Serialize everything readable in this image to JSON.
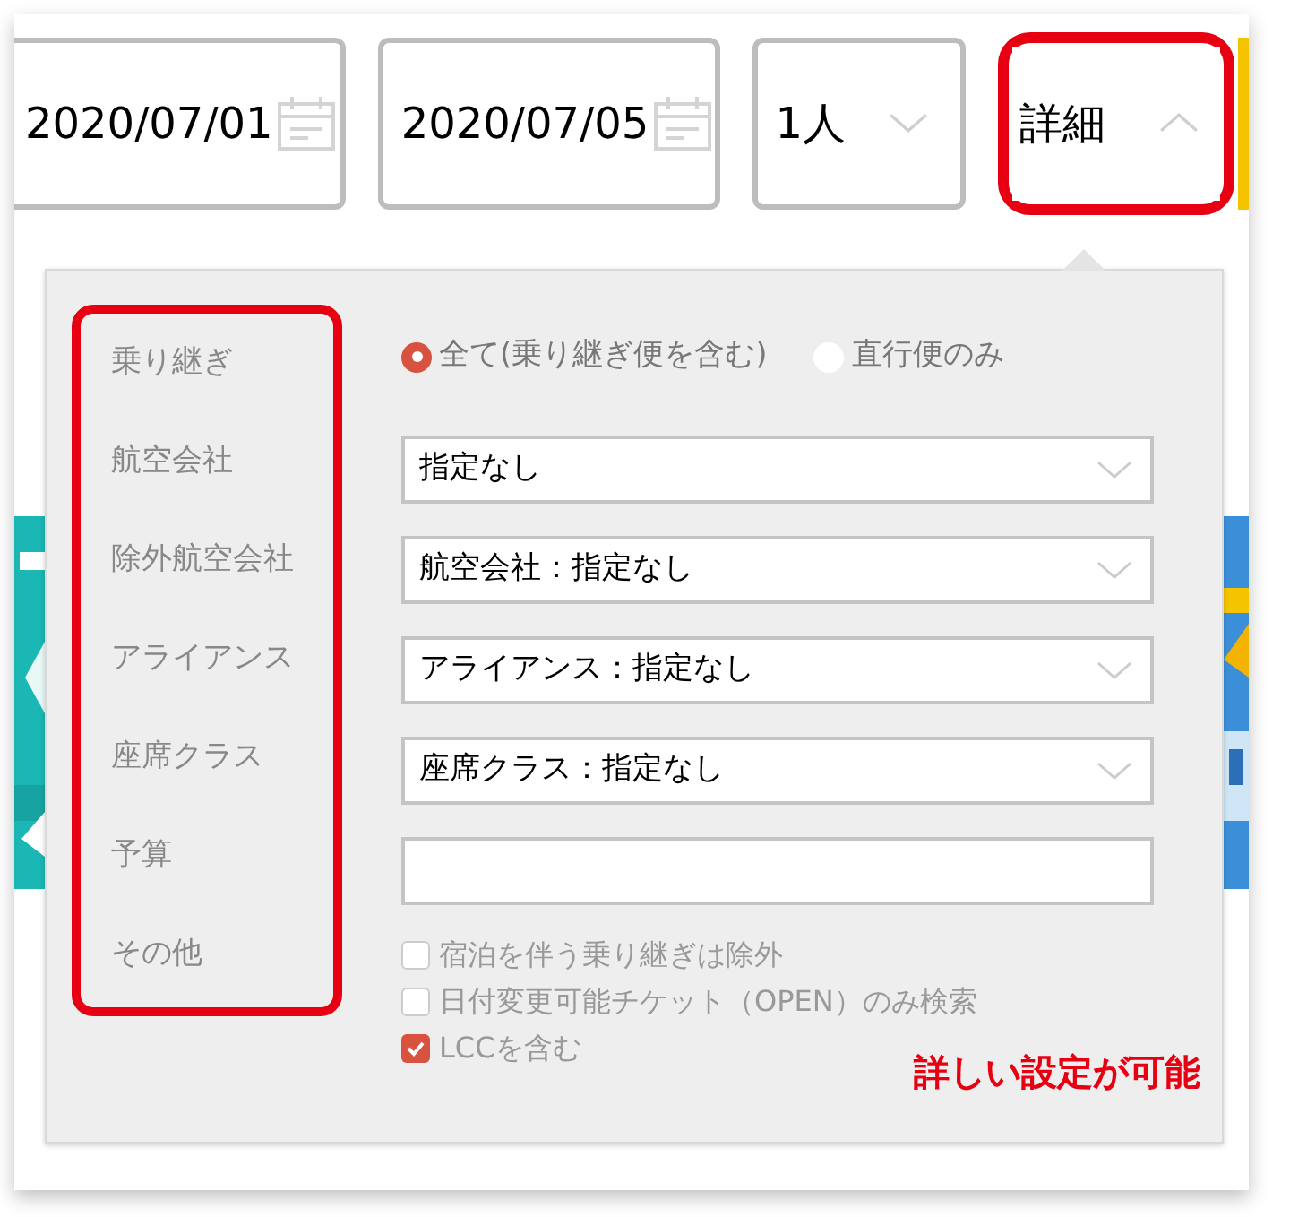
{
  "search_bar": {
    "fields": [
      {
        "kind": "date",
        "value": "2020/07/01"
      },
      {
        "kind": "date",
        "value": "2020/07/05"
      },
      {
        "kind": "select",
        "value": "1人"
      },
      {
        "kind": "toggle",
        "value": "詳細",
        "expanded": true,
        "highlighted": true
      }
    ]
  },
  "details_panel": {
    "labels_highlighted": true,
    "labels": [
      "乗り継ぎ",
      "航空会社",
      "除外航空会社",
      "アライアンス",
      "座席クラス",
      "予算",
      "その他"
    ],
    "transfer_options": [
      {
        "label": "全て(乗り継ぎ便を含む)",
        "selected": true
      },
      {
        "label": "直行便のみ",
        "selected": false
      }
    ],
    "selects": [
      "指定なし",
      "航空会社：指定なし",
      "アライアンス：指定なし",
      "座席クラス：指定なし"
    ],
    "checkboxes": [
      {
        "label": "宿泊を伴う乗り継ぎは除外",
        "checked": false
      },
      {
        "label": "日付変更可能チケット（OPEN）のみ検索",
        "checked": false
      },
      {
        "label": "LCCを含む",
        "checked": true
      }
    ],
    "annotation": "詳しい設定が可能"
  }
}
